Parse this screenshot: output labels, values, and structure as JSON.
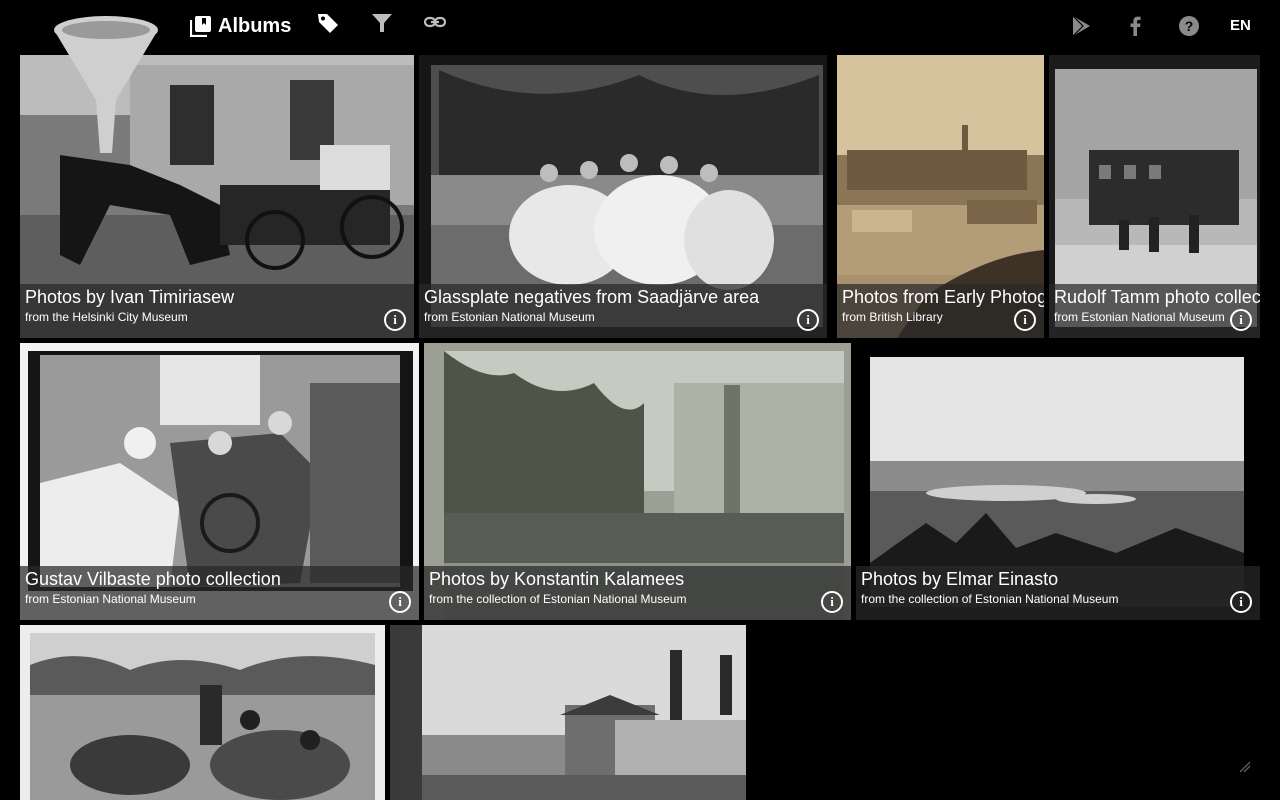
{
  "header": {
    "nav": {
      "albums_label": "Albums"
    },
    "language": "EN",
    "icons": {
      "logo": "funnel-logo",
      "albums": "albums-icon",
      "tag": "tag-icon",
      "filter": "filter-icon",
      "link": "link-icon",
      "play": "google-play-icon",
      "facebook": "facebook-icon",
      "help": "help-icon"
    }
  },
  "albums": [
    {
      "title": "Photos by Ivan Timiriasew",
      "source": "from the Helsinki City Museum"
    },
    {
      "title": "Glassplate negatives from Saadjärve area",
      "source": "from Estonian National Museum"
    },
    {
      "title": "Photos from Early Photog",
      "source": "from British Library"
    },
    {
      "title": "Rudolf Tamm photo collec",
      "source": "from Estonian National Museum"
    },
    {
      "title": "Gustav Vilbaste photo collection",
      "source": "from Estonian National Museum"
    },
    {
      "title": "Photos by Konstantin Kalamees",
      "source": "from the collection of Estonian National Museum"
    },
    {
      "title": "Photos by Elmar Einasto",
      "source": "from the collection of Estonian National Museum"
    },
    {
      "title": "",
      "source": ""
    },
    {
      "title": "",
      "source": ""
    }
  ]
}
